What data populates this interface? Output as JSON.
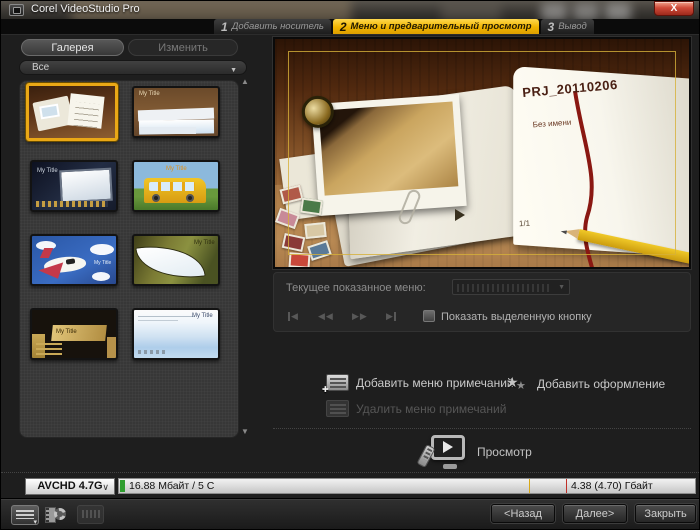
{
  "window": {
    "title": "Corel VideoStudio Pro",
    "close": "X"
  },
  "steps": [
    {
      "num": "1",
      "label": "Добавить носитель"
    },
    {
      "num": "2",
      "label": "Меню и предварительный просмотр"
    },
    {
      "num": "3",
      "label": "Вывод"
    }
  ],
  "left_panel": {
    "tabs": {
      "gallery": "Галерея",
      "edit": "Изменить"
    },
    "filter": {
      "value": "Все"
    },
    "thumbnails": [
      {
        "name": "travel-book",
        "title": "",
        "selected": true
      },
      {
        "name": "paper-scrapbook",
        "title": "My Title",
        "selected": false
      },
      {
        "name": "night-billboard",
        "title": "My Title",
        "selected": false
      },
      {
        "name": "school-bus",
        "title": "My Title",
        "selected": false
      },
      {
        "name": "cartoon-airplane",
        "title": "My Title",
        "selected": false
      },
      {
        "name": "leaf",
        "title": "My Title",
        "selected": false
      },
      {
        "name": "gold-panels",
        "title": "My Title",
        "selected": false
      },
      {
        "name": "sky-frame",
        "title": "My Title",
        "selected": false
      }
    ]
  },
  "preview": {
    "project_title": "PRJ_20110206",
    "subtitle": "Без имени",
    "page": "1/1"
  },
  "menu_controls": {
    "current_label": "Текущее показанное меню:",
    "dropdown_value": "",
    "show_button": "Показать выделенную кнопку"
  },
  "actions": {
    "add_note": "Добавить меню примечаний",
    "add_decor": "Добавить оформление",
    "remove_note": "Удалить меню примечаний",
    "preview": "Просмотр"
  },
  "status": {
    "format": "AVCHD 4.7G",
    "used": "16.88 Мбайт / 5 С",
    "capacity": "4.38 (4.70) Гбайт"
  },
  "footer": {
    "back": "<Назад",
    "next": "Далее>",
    "close": "Закрыть"
  },
  "icons": {
    "dropdown_arrow": "▼",
    "combo_arrow": "∨",
    "scroll_up": "▲",
    "scroll_down": "▼",
    "small_arrow": "▾",
    "prev": "◀",
    "next": "▶",
    "plus": "✚",
    "star_big": "★",
    "star_small": "★"
  },
  "colors": {
    "accent_yellow": "#f0b400",
    "selection_border": "#eaa816",
    "close_red": "#c0392b",
    "progress_green": "#2f9e2f"
  }
}
